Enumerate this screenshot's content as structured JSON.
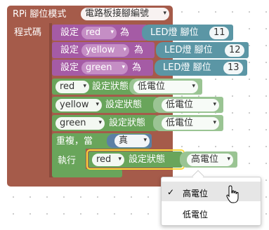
{
  "setup": {
    "header_label": "RPi 腳位模式",
    "mode_value": "電路板接腳編號",
    "section_label": "程式碼"
  },
  "set_pins": [
    {
      "keyword": "設定",
      "name": "red",
      "as": "為",
      "led_label": "LED燈 腳位",
      "pin": "11"
    },
    {
      "keyword": "設定",
      "name": "yellow",
      "as": "為",
      "led_label": "LED燈 腳位",
      "pin": "12"
    },
    {
      "keyword": "設定",
      "name": "green",
      "as": "為",
      "led_label": "LED燈 腳位",
      "pin": "13"
    }
  ],
  "set_states": [
    {
      "name": "red",
      "label": "設定狀態",
      "value": "低電位"
    },
    {
      "name": "yellow",
      "label": "設定狀態",
      "value": "低電位"
    },
    {
      "name": "green",
      "label": "設定狀態",
      "value": "低電位"
    }
  ],
  "loop": {
    "label": "重複，當",
    "condition": "真",
    "do_label": "執行",
    "inner": {
      "name": "red",
      "label": "設定狀態",
      "value": "高電位"
    }
  },
  "dropdown_menu": {
    "options": [
      {
        "label": "高電位",
        "checked": true,
        "check_mark": "✓"
      },
      {
        "label": "低電位",
        "checked": false,
        "check_mark": ""
      }
    ]
  },
  "colors": {
    "setup_block": "#a55b4a",
    "variable_block": "#a55ba5",
    "led_block": "#5b96a5",
    "state_block": "#69a55b",
    "loop_block": "#69a55b",
    "logic_block": "#5b80a5",
    "highlight": "#fbd63a"
  },
  "icons": {
    "dropdown": "caret-down-icon",
    "cursor": "hand-pointer-icon"
  }
}
